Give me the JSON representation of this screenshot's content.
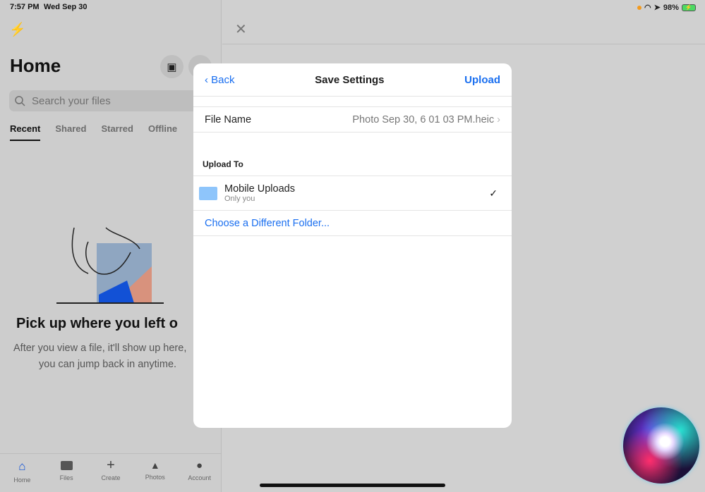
{
  "status": {
    "time": "7:57 PM",
    "date": "Wed Sep 30",
    "battery": "98%"
  },
  "left": {
    "title": "Home",
    "search_placeholder": "Search your files",
    "tabs": [
      "Recent",
      "Shared",
      "Starred",
      "Offline"
    ],
    "empty_heading": "Pick up where you left o",
    "empty_line1": "After you view a file, it'll show up here,",
    "empty_line2": "you can jump back in anytime."
  },
  "tabbar": [
    {
      "label": "Home",
      "icon": "home-icon"
    },
    {
      "label": "Files",
      "icon": "folder-icon"
    },
    {
      "label": "Create",
      "icon": "plus-icon"
    },
    {
      "label": "Photos",
      "icon": "photos-icon"
    },
    {
      "label": "Account",
      "icon": "account-icon"
    }
  ],
  "modal": {
    "back": "Back",
    "title": "Save Settings",
    "upload": "Upload",
    "file_name_label": "File Name",
    "file_name_value": "Photo Sep 30, 6 01 03 PM.heic",
    "upload_to": "Upload To",
    "folder_name": "Mobile Uploads",
    "folder_sub": "Only you",
    "choose_folder": "Choose a Different Folder..."
  },
  "colors": {
    "accent": "#1a6ff0",
    "home_active": "#0b4fd8",
    "folder": "#8ec5fb"
  }
}
